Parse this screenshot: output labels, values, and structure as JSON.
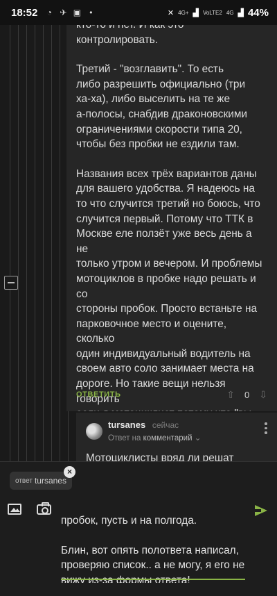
{
  "status_bar": {
    "time": "18:52",
    "network_top": "4G+",
    "network_label": "VoLTE2",
    "lte": "4G",
    "battery": "44%"
  },
  "comment": {
    "cut_line": "кто-то и нет. И как это контролировать.",
    "paragraphs": [
      "Третий - \"возглавить\". То есть\nлибо разрешить официально (три\nха-ха), либо выселить на те же\nа-полосы, снабдив драконовскими\nограничениями скорости типа 20,\nчтобы без пробки не ездили там.",
      "Названия всех трёх вариантов даны\nдля вашего удобства. Я надеюсь на\nто что случится третий но боюсь, что\nслучится первый. Потому что ТТК в\nМоскве еле ползёт уже весь день а не\nтолько утром и вечером. И проблемы\nмотоциклов в пробке надо решать и со\nстороны пробок. Просто встаньте на\nпарковочное место и оцените, сколько\nодин индивидуальный водитель на\nсвоем авто соло занимает места на\nдороге. Но такие вещи нельзя говорить\nесли я мотоциклист потому что \"вы\nи так охуели, двухколесные\". Можно\nподумать проблема от этого исчезла,\nага."
    ],
    "reply_label": "ОТВЕТИТЬ",
    "vote_count": "0"
  },
  "sub_comment": {
    "username": "tursanes",
    "time": "сейчас",
    "reply_prefix": "Ответ на",
    "reply_target": "комментарий",
    "text_preview": "Мотоциклисты вряд ли решат"
  },
  "reply_form": {
    "chip_label": "ответ",
    "chip_user": "tursanes",
    "text_lines": "пробок, пусть и на полгода.\n\nБлин, вот опять полответа написал,\nпроверяю список.. а не могу, я его не\nвижу из-за формы ответа!"
  },
  "colors": {
    "accent": "#8ab446",
    "background": "#1a1a1a",
    "card": "#262626"
  },
  "icons": [
    "signal-icon",
    "wifi-icon",
    "battery-icon",
    "image-icon",
    "camera-icon",
    "send-icon",
    "close-icon",
    "more-icon",
    "upvote-icon",
    "downvote-icon",
    "collapse-icon"
  ]
}
